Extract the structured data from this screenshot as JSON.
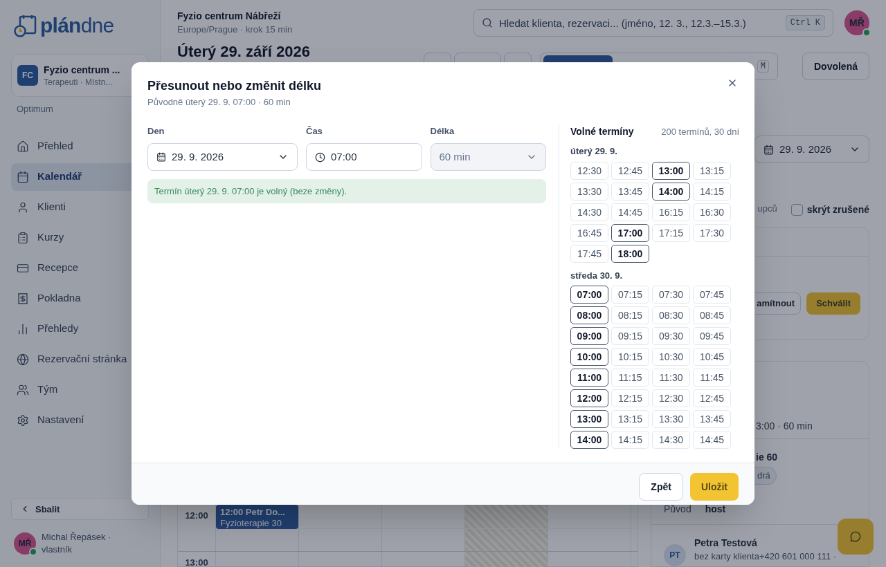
{
  "logo": {
    "bold": "plán",
    "light": "dne"
  },
  "workspace": {
    "initials": "FC",
    "name": "Fyzio centrum ...",
    "subtitle": "Terapeuti · Místn...",
    "plan": "Optimum"
  },
  "sidebar": {
    "items": [
      {
        "label": "Přehled",
        "selected": false
      },
      {
        "label": "Kalendář",
        "selected": true
      },
      {
        "label": "Klienti",
        "selected": false
      },
      {
        "label": "Kurzy",
        "selected": false
      },
      {
        "label": "Recepce",
        "selected": false
      },
      {
        "label": "Pokladna",
        "selected": false
      },
      {
        "label": "Přehledy",
        "selected": false
      },
      {
        "label": "Rezervační stránka",
        "selected": false
      },
      {
        "label": "Tým",
        "selected": false
      },
      {
        "label": "Nastavení",
        "selected": false
      }
    ],
    "collapse": "Sbalit",
    "user": {
      "initials": "MŘ",
      "name": "Michal Řepásek · vlastník",
      "online": true
    }
  },
  "header": {
    "title": "Fyzio centrum Nábřeží",
    "subtitle": "Europe/Prague · krok 15 min",
    "search": {
      "placeholder": "Hledat klienta, rezervaci... (jméno, 12. 3., 12.3.–15.3.)",
      "shortcut": "Ctrl K"
    },
    "avatar": {
      "initials": "MŘ",
      "online": true
    }
  },
  "toolbar": {
    "title": "Úterý 29. září 2026",
    "view_key": "M",
    "vacation": "Dovolená"
  },
  "calendar": {
    "hours": [
      "12:00",
      "13:00"
    ],
    "event": {
      "title": "12:00 Petr Do...",
      "service": "Fyzioterapie 30"
    }
  },
  "right_panel": {
    "date": "29. 9. 2026",
    "fragment": "upců",
    "hide_cancelled": {
      "label": "skrýt zrušené",
      "checked": false
    },
    "reject": "amítnout",
    "approve": "Schválit",
    "time": "3:00 · 60 min",
    "service": "ie 60",
    "tag": "drá",
    "origin_label": "Původ",
    "origin_value": "host",
    "client": {
      "initials": "PT",
      "name": "Petra Testová",
      "contact": "bez karty klienta+420 601 000 111 ·"
    }
  },
  "dialog": {
    "title": "Přesunout nebo změnit délku",
    "subtitle": "Původně úterý 29. 9. 07:00 · 60 min",
    "fields": [
      {
        "label": "Den",
        "value": "29. 9. 2026",
        "kind": "date"
      },
      {
        "label": "Čas",
        "value": "07:00",
        "kind": "time"
      },
      {
        "label": "Délka",
        "value": "60 min",
        "kind": "select"
      }
    ],
    "notice": "Termín úterý 29. 9. 07:00 je volný (beze změny).",
    "slots": {
      "title": "Volné termíny",
      "summary": "200 termínů, 30 dní",
      "days": [
        {
          "label": "úterý 29. 9.",
          "slots": [
            {
              "time": "12:30",
              "strong": false
            },
            {
              "time": "12:45",
              "strong": false
            },
            {
              "time": "13:00",
              "strong": true
            },
            {
              "time": "13:15",
              "strong": false
            },
            {
              "time": "13:30",
              "strong": false
            },
            {
              "time": "13:45",
              "strong": false
            },
            {
              "time": "14:00",
              "strong": true
            },
            {
              "time": "14:15",
              "strong": false
            },
            {
              "time": "14:30",
              "strong": false
            },
            {
              "time": "14:45",
              "strong": false
            },
            {
              "time": "16:15",
              "strong": false
            },
            {
              "time": "16:30",
              "strong": false
            },
            {
              "time": "16:45",
              "strong": false
            },
            {
              "time": "17:00",
              "strong": true
            },
            {
              "time": "17:15",
              "strong": false
            },
            {
              "time": "17:30",
              "strong": false
            },
            {
              "time": "17:45",
              "strong": false
            },
            {
              "time": "18:00",
              "strong": true
            }
          ]
        },
        {
          "label": "středa 30. 9.",
          "slots": [
            {
              "time": "07:00",
              "strong": true
            },
            {
              "time": "07:15",
              "strong": false
            },
            {
              "time": "07:30",
              "strong": false
            },
            {
              "time": "07:45",
              "strong": false
            },
            {
              "time": "08:00",
              "strong": true
            },
            {
              "time": "08:15",
              "strong": false
            },
            {
              "time": "08:30",
              "strong": false
            },
            {
              "time": "08:45",
              "strong": false
            },
            {
              "time": "09:00",
              "strong": true
            },
            {
              "time": "09:15",
              "strong": false
            },
            {
              "time": "09:30",
              "strong": false
            },
            {
              "time": "09:45",
              "strong": false
            },
            {
              "time": "10:00",
              "strong": true
            },
            {
              "time": "10:15",
              "strong": false
            },
            {
              "time": "10:30",
              "strong": false
            },
            {
              "time": "10:45",
              "strong": false
            },
            {
              "time": "11:00",
              "strong": true
            },
            {
              "time": "11:15",
              "strong": false
            },
            {
              "time": "11:30",
              "strong": false
            },
            {
              "time": "11:45",
              "strong": false
            },
            {
              "time": "12:00",
              "strong": true
            },
            {
              "time": "12:15",
              "strong": false
            },
            {
              "time": "12:30",
              "strong": false
            },
            {
              "time": "12:45",
              "strong": false
            },
            {
              "time": "13:00",
              "strong": true
            },
            {
              "time": "13:15",
              "strong": false
            },
            {
              "time": "13:30",
              "strong": false
            },
            {
              "time": "13:45",
              "strong": false
            },
            {
              "time": "14:00",
              "strong": true
            },
            {
              "time": "14:15",
              "strong": false
            },
            {
              "time": "14:30",
              "strong": false
            },
            {
              "time": "14:45",
              "strong": false
            }
          ]
        }
      ]
    },
    "buttons": {
      "back": "Zpět",
      "save": "Uložit"
    }
  }
}
